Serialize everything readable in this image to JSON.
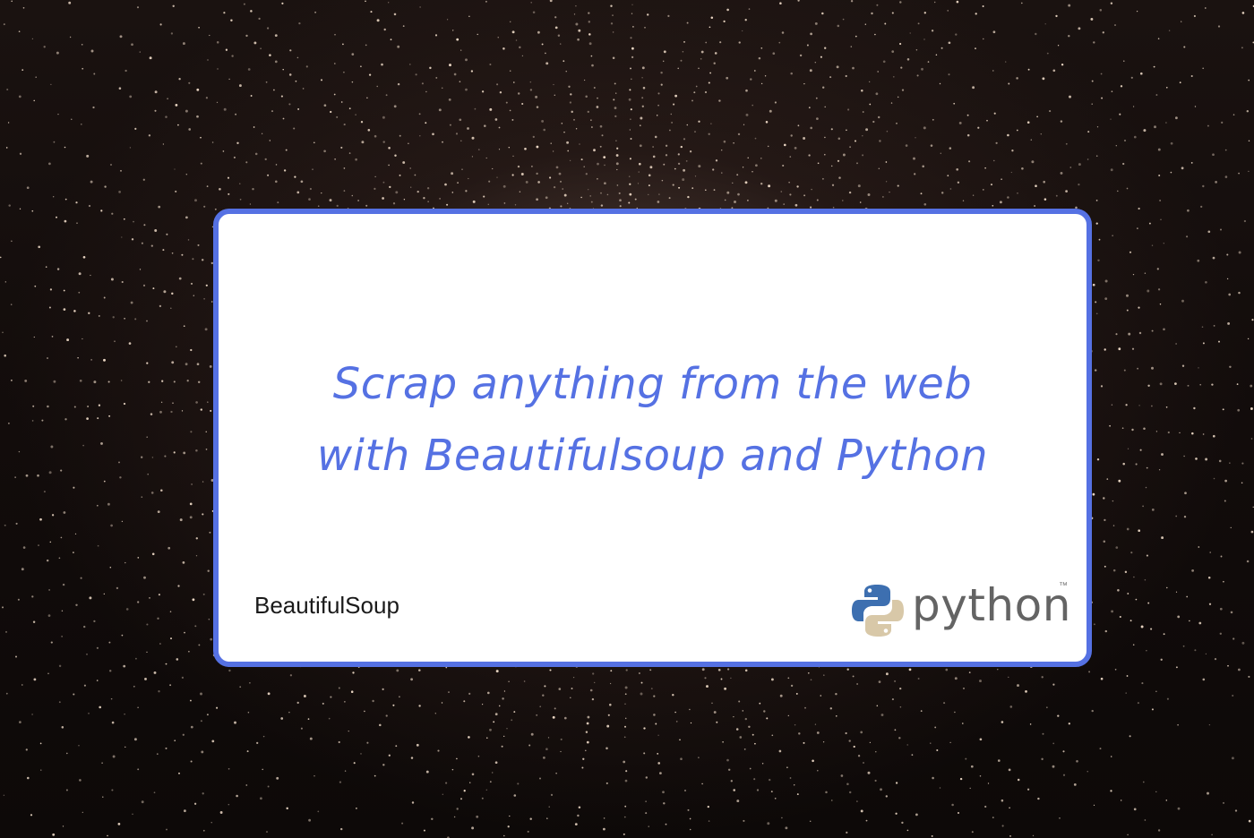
{
  "headline": {
    "line1": "Scrap anything from the web",
    "line2": "with Beautifulsoup and Python"
  },
  "logos": {
    "beautifulsoup": "BeautifulSoup",
    "python": "python",
    "python_tm": "™"
  },
  "colors": {
    "accent": "#5571e3",
    "card_background": "#ffffff",
    "background": "#120c0b"
  }
}
